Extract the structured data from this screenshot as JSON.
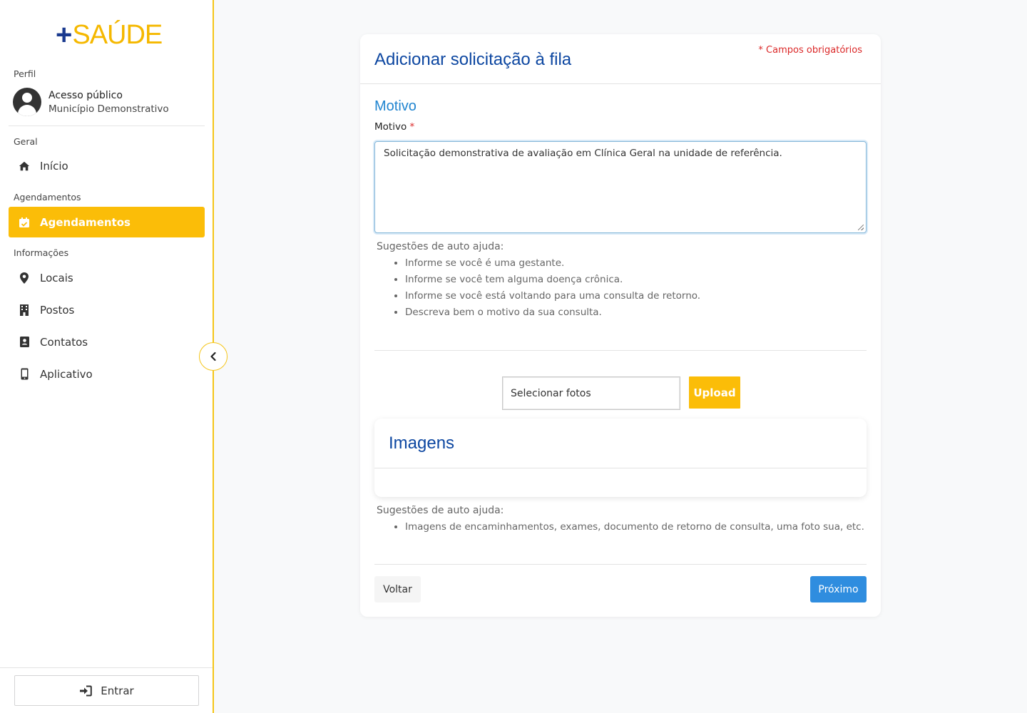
{
  "app": {
    "logo_plus": "+",
    "logo_word": "SAÚDE",
    "accent_color": "#fbbd08",
    "brand_blue": "#0d47a1"
  },
  "sidebar": {
    "profile_section": "Perfil",
    "profile_name": "Acesso público",
    "profile_city": "Município Demonstrativo",
    "groups": {
      "geral": "Geral",
      "agendamentos": "Agendamentos",
      "informacoes": "Informações"
    },
    "items": [
      {
        "label": "Início",
        "icon": "home-icon"
      },
      {
        "label": "Agendamentos",
        "icon": "calendar-check-icon",
        "active": true
      },
      {
        "label": "Locais",
        "icon": "map-marker-icon"
      },
      {
        "label": "Postos",
        "icon": "building-icon"
      },
      {
        "label": "Contatos",
        "icon": "address-book-icon"
      },
      {
        "label": "Aplicativo",
        "icon": "mobile-icon"
      }
    ],
    "login_label": "Entrar"
  },
  "form": {
    "title": "Adicionar solicitação à fila",
    "required_note": "* Campos obrigatórios",
    "section_title": "Motivo",
    "field_label": "Motivo",
    "required_mark": "*",
    "motivo_value": "Solicitação demonstrativa de avaliação em Clínica Geral na unidade de referência.",
    "help_title": "Sugestões de auto ajuda:",
    "help_items": [
      "Informe se você é uma gestante.",
      "Informe se você tem alguma doença crônica.",
      "Informe se você está voltando para uma consulta de retorno.",
      "Descreva bem o motivo da sua consulta."
    ],
    "file_placeholder": "Selecionar fotos",
    "upload_label": "Upload",
    "images_title": "Imagens",
    "images_help_title": "Sugestões de auto ajuda:",
    "images_help_items": [
      "Imagens de encaminhamentos, exames, documento de retorno de consulta, uma foto sua, etc."
    ],
    "back_label": "Voltar",
    "next_label": "Próximo"
  }
}
